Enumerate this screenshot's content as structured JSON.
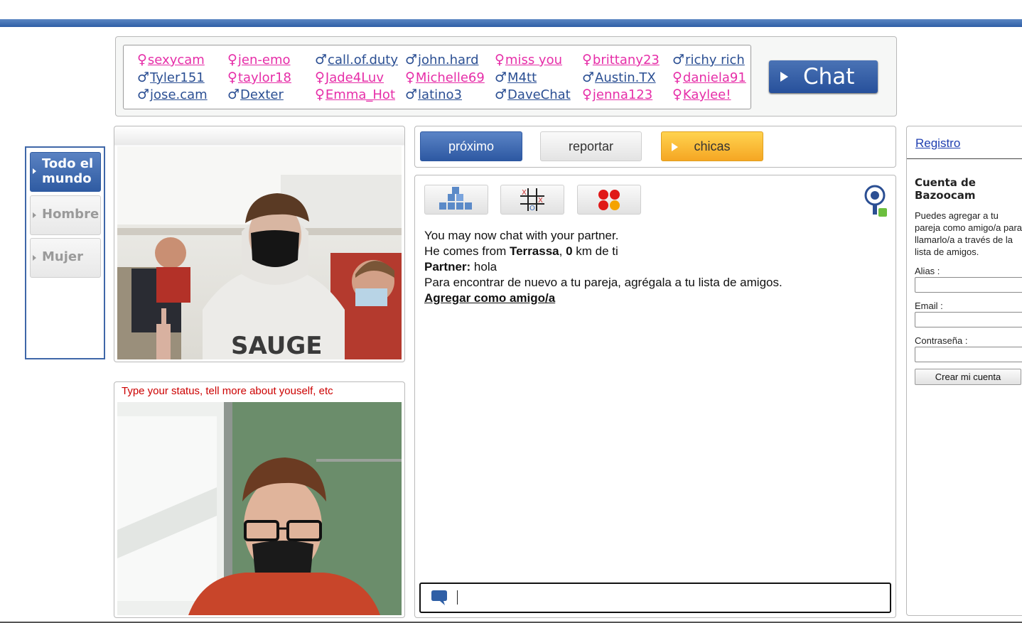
{
  "online_users": [
    {
      "gender": "female",
      "symbol": "♀",
      "name": "sexycam"
    },
    {
      "gender": "female",
      "symbol": "♀",
      "name": "jen-emo"
    },
    {
      "gender": "male",
      "symbol": "♂",
      "name": "call.of.duty"
    },
    {
      "gender": "male",
      "symbol": "♂",
      "name": "john.hard"
    },
    {
      "gender": "female",
      "symbol": "♀",
      "name": "miss you"
    },
    {
      "gender": "female",
      "symbol": "♀",
      "name": "brittany23"
    },
    {
      "gender": "male",
      "symbol": "♂",
      "name": "richy rich"
    },
    {
      "gender": "male",
      "symbol": "♂",
      "name": "Tyler151"
    },
    {
      "gender": "female",
      "symbol": "♀",
      "name": "taylor18"
    },
    {
      "gender": "female",
      "symbol": "♀",
      "name": "Jade4Luv"
    },
    {
      "gender": "female",
      "symbol": "♀",
      "name": "Michelle69"
    },
    {
      "gender": "male",
      "symbol": "♂",
      "name": "M4tt"
    },
    {
      "gender": "male",
      "symbol": "♂",
      "name": "Austin.TX"
    },
    {
      "gender": "female",
      "symbol": "♀",
      "name": "daniela91"
    },
    {
      "gender": "male",
      "symbol": "♂",
      "name": "jose.cam"
    },
    {
      "gender": "male",
      "symbol": "♂",
      "name": "Dexter"
    },
    {
      "gender": "female",
      "symbol": "♀",
      "name": "Emma_Hot"
    },
    {
      "gender": "male",
      "symbol": "♂",
      "name": "latino3"
    },
    {
      "gender": "male",
      "symbol": "♂",
      "name": "DaveChat"
    },
    {
      "gender": "female",
      "symbol": "♀",
      "name": "jenna123"
    },
    {
      "gender": "female",
      "symbol": "♀",
      "name": "Kaylee!"
    }
  ],
  "chat_button": {
    "label": "Chat"
  },
  "filter": {
    "items": [
      {
        "label": "Todo el mundo",
        "active": true
      },
      {
        "label": "Hombre",
        "active": false
      },
      {
        "label": "Mujer",
        "active": false
      }
    ]
  },
  "self_video": {
    "status_placeholder": "Type your status, tell more about youself, etc"
  },
  "controls": {
    "next": "próximo",
    "report": "reportar",
    "girls": "chicas"
  },
  "games": [
    {
      "icon": "blocks-game-icon"
    },
    {
      "icon": "tic-tac-toe-icon"
    },
    {
      "icon": "connect-dots-icon"
    }
  ],
  "chat": {
    "line1": "You may now chat with your partner.",
    "line2_prefix": "He comes from",
    "city": "Terrassa",
    "distance": "0",
    "line2_suffix": "km de ti",
    "partner_label": "Partner:",
    "partner_message": "hola",
    "line4": "Para encontrar de nuevo a tu pareja, agrégala a tu lista de amigos.",
    "add_friend": "Agregar como amigo/a",
    "input_value": ""
  },
  "account": {
    "register_link": "Registro",
    "title_line1": "Cuenta de",
    "title_line2": "Bazoocam",
    "description": "Puedes agregar a tu pareja como amigo/a para llamarlo/a a través de la lista de amigos.",
    "alias_label": "Alias :",
    "email_label": "Email :",
    "password_label": "Contraseña :",
    "create_button": "Crear mi cuenta"
  },
  "colors": {
    "brand_blue": "#2f5fa6",
    "female_pink": "#e62ea8",
    "male_blue": "#2b4f93",
    "status_red": "#cc0000",
    "girls_orange": "#f5a623"
  }
}
